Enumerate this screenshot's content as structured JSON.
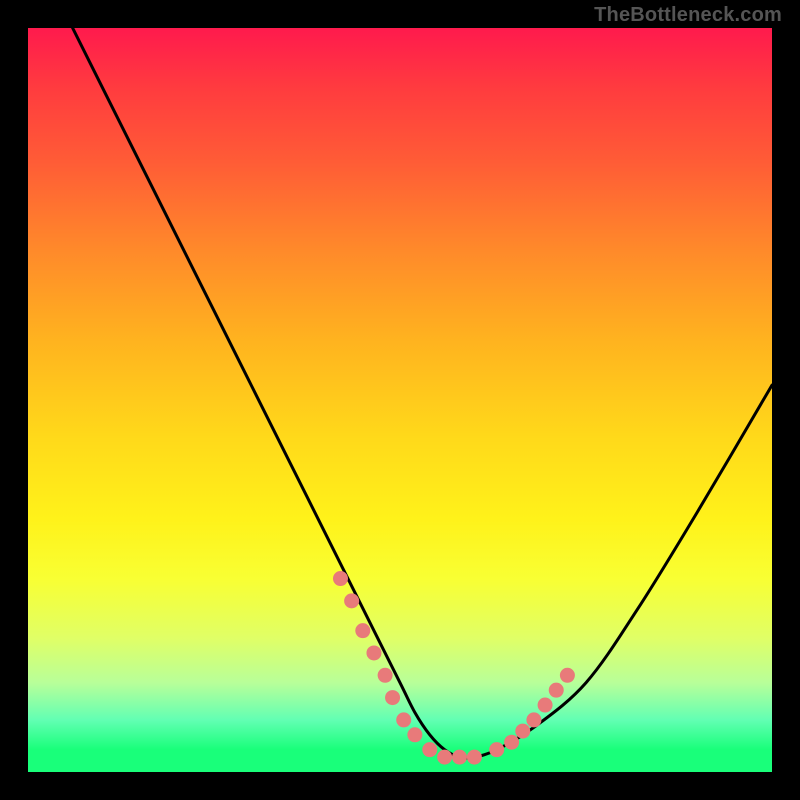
{
  "watermark": "TheBottleneck.com",
  "chart_data": {
    "type": "line",
    "title": "",
    "xlabel": "",
    "ylabel": "",
    "xlim": [
      0,
      100
    ],
    "ylim": [
      0,
      100
    ],
    "series": [
      {
        "name": "curve",
        "x": [
          6,
          10,
          15,
          20,
          25,
          30,
          35,
          40,
          45,
          50,
          52,
          54,
          56,
          58,
          60,
          63,
          68,
          75,
          82,
          90,
          100
        ],
        "values": [
          100,
          92,
          82,
          72,
          62,
          52,
          42,
          32,
          22,
          12,
          8,
          5,
          3,
          2,
          2,
          3,
          6,
          12,
          22,
          35,
          52
        ]
      }
    ],
    "marker_series": {
      "name": "highlighted-points",
      "color": "#e87a7a",
      "x": [
        42,
        43.5,
        45,
        46.5,
        48,
        49,
        50.5,
        52,
        54,
        56,
        58,
        60,
        63,
        65,
        66.5,
        68,
        69.5,
        71,
        72.5
      ],
      "values": [
        26,
        23,
        19,
        16,
        13,
        10,
        7,
        5,
        3,
        2,
        2,
        2,
        3,
        4,
        5.5,
        7,
        9,
        11,
        13
      ]
    },
    "gradient": {
      "type": "vertical",
      "stops": [
        {
          "pos": 0.0,
          "color": "#ff1a4d"
        },
        {
          "pos": 0.3,
          "color": "#ff8a2a"
        },
        {
          "pos": 0.55,
          "color": "#ffd91a"
        },
        {
          "pos": 0.75,
          "color": "#f8ff33"
        },
        {
          "pos": 0.93,
          "color": "#62ffb3"
        },
        {
          "pos": 1.0,
          "color": "#19ff7a"
        }
      ]
    }
  }
}
